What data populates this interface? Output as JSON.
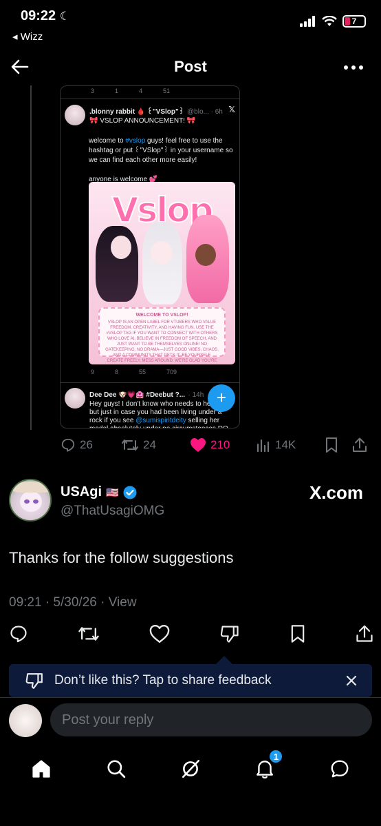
{
  "status": {
    "time": "09:22",
    "back_app": "Wizz",
    "battery": "7"
  },
  "header": {
    "title": "Post"
  },
  "embedded": {
    "top_stats": [
      "3",
      "1",
      "4",
      "51"
    ],
    "author_name": ".blonny rabbit 🩸 ꒰\"VSlop\"꒱",
    "author_handle": "@blo... · 6h",
    "headline": "🎀 VSLOP ANNOUNCEMENT! 🎀",
    "line1_pre": "welcome to ",
    "hashtag": "#vslop",
    "line1_post": " guys! feel free to use the hashtag or put ꒰\"VSlop\"꒱ in your username so we can find each other more easily!",
    "line2": "anyone is welcome 💕",
    "image_logo": "Vslop",
    "image_card_title": "WELCOME TO VSLOP!",
    "image_card_text": "VSLOP IS AN OPEN LABEL FOR VTUBERS WHO VALUE FREEDOM, CREATIVITY, AND HAVING FUN. USE THE #VSLOP TAG IF YOU WANT TO CONNECT WITH OTHERS WHO LOVE AI, BELIEVE IN FREEDOM OF SPEECH, AND JUST WANT TO BE THEMSELVES ONLINE! NO GATEKEEPING. NO DRAMA—JUST GOOD VIBES, CHAOS, AND A COMMUNITY THAT GETS IT. BE YOURSELF. CREATE FREELY. MESS AROUND. WE'RE GLAD YOU'RE HERE.",
    "bottom_stats": [
      "9",
      "8",
      "55",
      "709"
    ],
    "reply_name": "Dee Dee 🐶💗🏩 #Deebut ?...",
    "reply_time": "· 14h",
    "reply_pre": "Hey guys! I don't know who needs to hear this but just in case you had been living under a rock if you see ",
    "reply_mention": "@sumispiritdeity",
    "reply_post": " selling her model absolutely under no circumstances DO NOT"
  },
  "quoted_stats": {
    "replies": "26",
    "reposts": "24",
    "likes": "210",
    "views": "14K"
  },
  "post": {
    "display_name": "USAgi",
    "flag": "🇺🇸",
    "handle": "@ThatUsagiOMG",
    "watermark": "X.com",
    "text": "Thanks for the follow suggestions",
    "meta": "09:21 · 5/30/26 · View"
  },
  "feedback": {
    "text": "Don’t like this? Tap to share feedback"
  },
  "reply": {
    "placeholder": "Post your reply"
  },
  "tabbar": {
    "notifications_badge": "1"
  },
  "colors": {
    "accent": "#1d9bf0",
    "like": "#f91880",
    "feedback_bg": "#0e1a3a"
  }
}
